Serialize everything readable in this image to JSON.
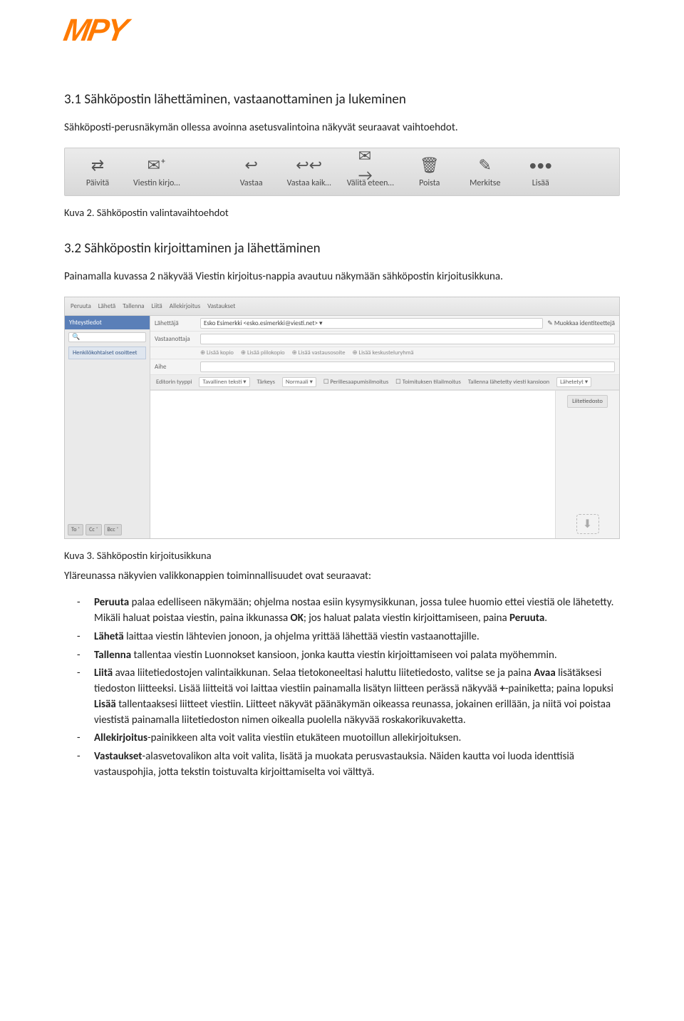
{
  "logo": {
    "text": "MPY"
  },
  "section1": {
    "heading": "3.1 Sähköpostin lähettäminen, vastaanottaminen ja lukeminen",
    "para": "Sähköposti-perusnäkymän ollessa avoinna asetusvalintoina näkyvät seuraavat vaihtoehdot."
  },
  "toolbar": {
    "items": [
      {
        "icon": "⇄",
        "label": "Päivitä"
      },
      {
        "icon": "✉⁺",
        "label": "Viestin kirjo…"
      },
      {
        "icon": "↩",
        "label": "Vastaa"
      },
      {
        "icon": "↩↩",
        "label": "Vastaa kaik…"
      },
      {
        "icon": "✉→",
        "label": "Välitä eteen…"
      },
      {
        "icon": "🗑",
        "label": "Poista"
      },
      {
        "icon": "✎",
        "label": "Merkitse"
      },
      {
        "icon": "•••",
        "label": "Lisää"
      }
    ]
  },
  "caption2": "Kuva 2. Sähköpostin valintavaihtoehdot",
  "section2": {
    "heading": "3.2 Sähköpostin kirjoittaminen ja lähettäminen",
    "para": "Painamalla kuvassa 2 näkyvää Viestin kirjoitus-nappia avautuu näkymään sähköpostin kirjoitusikkuna."
  },
  "compose": {
    "top": [
      "Peruuta",
      "Lähetä",
      "Tallenna",
      "Liitä",
      "Allekirjoitus",
      "Vastaukset"
    ],
    "side_head": "Yhteystiedot",
    "side_item": "Henkilökohtaiset osoitteet",
    "side_foot": [
      "To ⁺",
      "Cc ⁺",
      "Bcc ⁺"
    ],
    "rows": {
      "from_lbl": "Lähettäjä",
      "from_val": "Esko Esimerkki <esko.esimerkki@viesti.net> ▾",
      "from_edit": "✎ Muokkaa identiteettejä",
      "to_lbl": "Vastaanottaja",
      "subj_lbl": "Aihe"
    },
    "opts": [
      "⊕ Lisää kopio",
      "⊕ Lisää piilokopio",
      "⊕ Lisää vastausosoite",
      "⊕ Lisää keskusteluryhmä"
    ],
    "editor": {
      "type_lbl": "Editorin tyyppi",
      "type_val": "Tavallinen teksti ▾",
      "prio_lbl": "Tärkeys",
      "prio_val": "Normaali ▾",
      "cb1": "Perillesaapumisilmoitus",
      "cb2": "Toimituksen tilailmoitus",
      "save_lbl": "Tallenna lähetetty viesti kansioon",
      "save_val": "Lähetetyt ▾"
    },
    "attach_btn": "Liitetiedosto",
    "drop": "⬇"
  },
  "caption3": "Kuva 3. Sähköpostin kirjoitusikkuna",
  "after3": "Yläreunassa näkyvien valikkonappien toiminnallisuudet ovat seuraavat:",
  "bullets": {
    "b1a": "Peruuta",
    "b1b": " palaa edelliseen näkymään; ohjelma nostaa esiin kysymysikkunan, jossa tulee huomio ettei viestiä ole lähetetty. Mikäli haluat poistaa viestin, paina ikkunassa ",
    "b1c": "OK",
    "b1d": "; jos haluat palata viestin kirjoittamiseen, paina ",
    "b1e": "Peruuta",
    "b1f": ".",
    "b2a": "Lähetä",
    "b2b": " laittaa viestin lähtevien jonoon, ja ohjelma yrittää lähettää viestin vastaanottajille.",
    "b3a": "Tallenna",
    "b3b": " tallentaa viestin Luonnokset kansioon, jonka kautta viestin kirjoittamiseen voi palata myöhemmin.",
    "b4a": "Liitä",
    "b4b": " avaa liitetiedostojen valintaikkunan. Selaa tietokoneeltasi haluttu liitetiedosto, valitse se ja paina ",
    "b4c": "Avaa",
    "b4d": " lisätäksesi tiedoston liitteeksi. Lisää liitteitä voi laittaa viestiin painamalla lisätyn liitteen perässä näkyvää ",
    "b4e": "+",
    "b4f": "-painiketta; paina lopuksi ",
    "b4g": "Lisää",
    "b4h": " tallentaaksesi liitteet viestiin. Liitteet näkyvät päänäkymän oikeassa reunassa, jokainen erillään, ja niitä voi poistaa viestistä painamalla liitetiedoston nimen oikealla puolella näkyvää roskakorikuvaketta.",
    "b5a": "Allekirjoitus",
    "b5b": "-painikkeen alta voit valita viestiin etukäteen muotoillun allekirjoituksen.",
    "b6a": "Vastaukset",
    "b6b": "-alasvetovalikon alta voit valita, lisätä ja muokata perusvastauksia. Näiden kautta voi luoda identtisiä vastauspohjia, jotta tekstin toistuvalta kirjoittamiselta voi välttyä."
  }
}
